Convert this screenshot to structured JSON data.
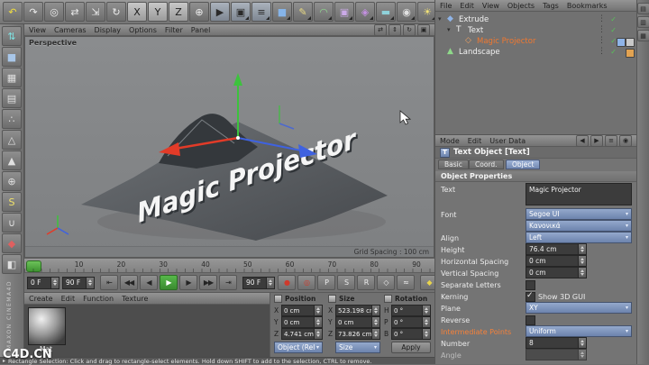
{
  "top_toolbar": {
    "icons": [
      {
        "name": "undo",
        "glyph": "↶",
        "color": "#f2df3e"
      },
      {
        "name": "redo",
        "glyph": "↷",
        "color": "#ececec"
      },
      {
        "name": "live-selection",
        "glyph": "◎",
        "color": "#ececec"
      },
      {
        "name": "move",
        "glyph": "⇄",
        "color": "#ececec"
      },
      {
        "name": "scale",
        "glyph": "⇲",
        "color": "#ececec"
      },
      {
        "name": "rotate",
        "glyph": "↻",
        "color": "#ececec"
      },
      {
        "name": "lock-x-axis",
        "glyph": "X",
        "color": "#1d1d1d",
        "bg": "linear-gradient(#c8c8c8,#9a9a9a)"
      },
      {
        "name": "lock-y-axis",
        "glyph": "Y",
        "color": "#1d1d1d",
        "bg": "linear-gradient(#c8c8c8,#9a9a9a)"
      },
      {
        "name": "lock-z-axis",
        "glyph": "Z",
        "color": "#1d1d1d",
        "bg": "linear-gradient(#c8c8c8,#9a9a9a)"
      },
      {
        "name": "coordinate-system",
        "glyph": "⊕",
        "color": "#ececec"
      },
      {
        "name": "render-view",
        "glyph": "▶",
        "color": "#2a2a2a",
        "bg": "linear-gradient(#aab2bc,#7e8792)"
      },
      {
        "name": "render-picture-viewer",
        "glyph": "▣",
        "color": "#2a2a2a",
        "bg": "linear-gradient(#aab2bc,#7e8792)",
        "dd": true
      },
      {
        "name": "render-settings",
        "glyph": "≡",
        "color": "#2a2a2a",
        "bg": "linear-gradient(#aab2bc,#7e8792)",
        "dd": true
      },
      {
        "name": "add-primitive-cube",
        "glyph": "■",
        "color": "#86b4e8",
        "dd": true
      },
      {
        "name": "add-spline",
        "glyph": "✎",
        "color": "#e8d982",
        "dd": true
      },
      {
        "name": "add-nurbs",
        "glyph": "◠",
        "color": "#8fd98f",
        "dd": true
      },
      {
        "name": "add-modeling",
        "glyph": "▣",
        "color": "#cbaae8",
        "dd": true
      },
      {
        "name": "add-deformer",
        "glyph": "◈",
        "color": "#c490e2",
        "dd": true
      },
      {
        "name": "add-environment",
        "glyph": "▬",
        "color": "#8fd2da",
        "dd": true
      },
      {
        "name": "add-camera",
        "glyph": "◉",
        "color": "#e0e0e0",
        "dd": true
      },
      {
        "name": "add-light",
        "glyph": "☀",
        "color": "#f2e276",
        "dd": true
      },
      {
        "name": "sound",
        "glyph": "♪",
        "color": "#e0e0e0",
        "dd": true
      }
    ]
  },
  "left_toolbar": {
    "brand": "MAXON CINEMA4D",
    "icons": [
      {
        "name": "make-editable",
        "glyph": "⇅",
        "color": "#7fe0e0"
      },
      {
        "name": "model-mode",
        "glyph": "■",
        "color": "#a8c6e8"
      },
      {
        "name": "texture-mode",
        "glyph": "▦",
        "color": "#e0e0e0"
      },
      {
        "name": "workplane-mode",
        "glyph": "▤",
        "color": "#e0e0e0"
      },
      {
        "name": "points-mode",
        "glyph": "∴",
        "color": "#e0e0e0"
      },
      {
        "name": "edges-mode",
        "glyph": "△",
        "color": "#e0e0e0"
      },
      {
        "name": "polygons-mode",
        "glyph": "▲",
        "color": "#e0e0e0"
      },
      {
        "name": "axis-lock",
        "glyph": "⊕",
        "color": "#e0e0e0"
      },
      {
        "name": "snap",
        "glyph": "S",
        "color": "#f0e26a"
      },
      {
        "name": "magnet-snap",
        "glyph": "∪",
        "color": "#e0e0e0"
      },
      {
        "name": "keyframe-mode",
        "glyph": "◆",
        "color": "#e06060"
      },
      {
        "name": "paint-mode",
        "glyph": "◧",
        "color": "#e0e0e0"
      }
    ]
  },
  "viewport": {
    "menu": [
      "View",
      "Cameras",
      "Display",
      "Options",
      "Filter",
      "Panel"
    ],
    "view_icons": [
      {
        "name": "viewport-pan",
        "glyph": "⇄"
      },
      {
        "name": "viewport-dolly",
        "glyph": "⇕"
      },
      {
        "name": "viewport-orbit",
        "glyph": "↻"
      },
      {
        "name": "viewport-toggle",
        "glyph": "▣"
      }
    ],
    "label": "Perspective",
    "grid_spacing": "Grid Spacing : 100 cm",
    "scene_text": "Magic Projector"
  },
  "timeline": {
    "ticks": [
      "0",
      "10",
      "20",
      "30",
      "40",
      "50",
      "60",
      "70",
      "80",
      "90"
    ],
    "current_frame": "0 F",
    "end_frame": "90 F",
    "range_end": "90 F",
    "transport": [
      {
        "name": "goto-start",
        "glyph": "⇤"
      },
      {
        "name": "previous-key",
        "glyph": "◀◀"
      },
      {
        "name": "previous-frame",
        "glyph": "◀"
      },
      {
        "name": "play-forward",
        "glyph": "▶",
        "cls": "play"
      },
      {
        "name": "next-frame",
        "glyph": "▶"
      },
      {
        "name": "next-key",
        "glyph": "▶▶"
      },
      {
        "name": "goto-end",
        "glyph": "⇥"
      }
    ],
    "record": [
      {
        "name": "record-keyframe",
        "glyph": "●",
        "color": "#cf3a2c"
      },
      {
        "name": "autokeying",
        "glyph": "◎",
        "color": "#cf3a2c"
      },
      {
        "name": "record-position",
        "glyph": "P",
        "color": "#ececec"
      },
      {
        "name": "record-scale",
        "glyph": "S",
        "color": "#ececec"
      },
      {
        "name": "record-rotation",
        "glyph": "R",
        "color": "#ececec"
      },
      {
        "name": "record-parameter",
        "glyph": "◇",
        "color": "#ececec"
      },
      {
        "name": "record-pla",
        "glyph": "≈",
        "color": "#ececec"
      }
    ],
    "extra": [
      {
        "name": "keyframe-selection",
        "glyph": "◆",
        "color": "#e8d44c"
      },
      {
        "name": "solo",
        "glyph": "◎",
        "color": "#e0e0e0"
      }
    ]
  },
  "material_panel": {
    "menu": [
      "Create",
      "Edit",
      "Function",
      "Texture"
    ],
    "material_name": "Mat"
  },
  "coordinates": {
    "columns": [
      {
        "title": "Position",
        "rows": [
          {
            "axis": "X",
            "value": "0 cm"
          },
          {
            "axis": "Y",
            "value": "0 cm"
          },
          {
            "axis": "Z",
            "value": "4.741 cm"
          }
        ]
      },
      {
        "title": "Size",
        "rows": [
          {
            "axis": "X",
            "value": "523.198 cm"
          },
          {
            "axis": "Y",
            "value": "0 cm"
          },
          {
            "axis": "Z",
            "value": "73.826 cm"
          }
        ]
      },
      {
        "title": "Rotation",
        "rows": [
          {
            "axis": "H",
            "value": "0 °"
          },
          {
            "axis": "P",
            "value": "0 °"
          },
          {
            "axis": "B",
            "value": "0 °"
          }
        ]
      }
    ],
    "mode_dropdown": "Object (Rel)",
    "size_dropdown": "Size",
    "apply_label": "Apply"
  },
  "object_manager": {
    "menu": [
      "File",
      "Edit",
      "View",
      "Objects",
      "Tags",
      "Bookmarks"
    ],
    "objects": [
      {
        "name": "Extrude",
        "depth": 0,
        "caret": "▾",
        "icon_glyph": "◆",
        "icon_color": "#8fb4e8",
        "check": true,
        "tags": []
      },
      {
        "name": "Text",
        "depth": 1,
        "caret": "▾",
        "icon_glyph": "T",
        "icon_color": "#f0f0f0",
        "check": true,
        "tags": []
      },
      {
        "name": "Magic Projector",
        "depth": 2,
        "caret": "",
        "icon_glyph": "◇",
        "icon_color": "#f0a060",
        "selected": true,
        "check": true,
        "tags": [
          "#c9c9c9",
          "#8fb4e8"
        ]
      },
      {
        "name": "Landscape",
        "depth": 0,
        "caret": "",
        "icon_glyph": "▲",
        "icon_color": "#8fd98a",
        "check": true,
        "tags": [
          "#e2a352"
        ]
      }
    ]
  },
  "right_strip": {
    "icons": [
      {
        "name": "layout-objects-tab",
        "glyph": "▤"
      },
      {
        "name": "layout-structure-tab",
        "glyph": "▥"
      },
      {
        "name": "layout-browser-tab",
        "glyph": "▦"
      }
    ]
  },
  "attributes": {
    "menu": [
      "Mode",
      "Edit",
      "User Data"
    ],
    "icons": [
      {
        "name": "nav-back",
        "glyph": "◀"
      },
      {
        "name": "nav-forward",
        "glyph": "▶"
      },
      {
        "name": "am-menu",
        "glyph": "≡"
      },
      {
        "name": "am-lock",
        "glyph": "◉"
      }
    ],
    "title": "Text Object [Text]",
    "tabs": [
      "Basic",
      "Coord.",
      "Object"
    ],
    "section": "Object Properties",
    "text_label": "Text",
    "text_value": "Magic Projector",
    "font_label": "Font",
    "font_value": "Segoe UI",
    "font_style_value": "Κανονικά",
    "align_label": "Align",
    "align_value": "Left",
    "height_label": "Height",
    "height_value": "76.4 cm",
    "hspacing_label": "Horizontal Spacing",
    "hspacing_value": "0 cm",
    "vspacing_label": "Vertical Spacing",
    "vspacing_value": "0 cm",
    "separate_label": "Separate Letters",
    "kerning_label": "Kerning",
    "show_gui_label": "Show 3D GUI",
    "plane_label": "Plane",
    "plane_value": "XY",
    "reverse_label": "Reverse",
    "intermediate_label": "Intermediate Points",
    "intermediate_value": "Uniform",
    "number_label": "Number",
    "number_value": "8",
    "angle_label": "Angle",
    "angle_value": ""
  },
  "status_bar": {
    "text": "Rectangle Selection: Click and drag to rectangle-select elements. Hold down SHIFT to add to the selection, CTRL to remove."
  },
  "watermark": {
    "text": "C4D.CN"
  }
}
